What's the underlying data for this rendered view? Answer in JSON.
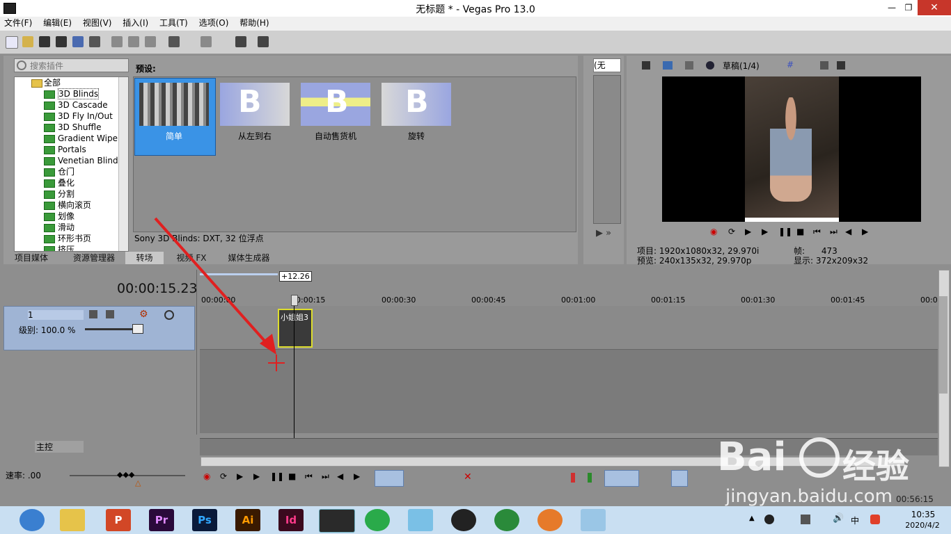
{
  "window": {
    "title": "无标题 * - Vegas Pro 13.0"
  },
  "menu": [
    "文件(F)",
    "编辑(E)",
    "视图(V)",
    "插入(I)",
    "工具(T)",
    "选项(O)",
    "帮助(H)"
  ],
  "plugins": {
    "search_placeholder": "搜索插件",
    "tree": [
      "全部",
      "3D Blinds",
      "3D Cascade",
      "3D Fly In/Out",
      "3D Shuffle",
      "Gradient Wipe",
      "Portals",
      "Venetian Blinds",
      "仓门",
      "叠化",
      "分割",
      "横向滚页",
      "划像",
      "滑动",
      "环形书页",
      "挤压"
    ],
    "presets_label": "预设:",
    "presets": [
      "简单",
      "从左到右",
      "自动售货机",
      "旋转"
    ],
    "status": "Sony 3D Blinds: DXT, 32 位浮点",
    "tabs": [
      "项目媒体",
      "资源管理器",
      "转场",
      "视频 FX",
      "媒体生成器"
    ]
  },
  "trimmer": {
    "dropdown": "(无"
  },
  "preview": {
    "quality": "草稿(1/4)",
    "project_label": "项目:",
    "project_value": "1920x1080x32, 29.970i",
    "preview_label": "预览:",
    "preview_value": "240x135x32, 29.970p",
    "frame_label": "帧:",
    "frame_value": "473",
    "display_label": "显示:",
    "display_value": "372x209x32"
  },
  "timeline": {
    "time": "00:00:15.23",
    "offset": "+12.26",
    "ruler": [
      "00:00:00",
      "00:00:15",
      "00:00:30",
      "00:00:45",
      "00:01:00",
      "00:01:15",
      "00:01:30",
      "00:01:45",
      "00:0"
    ],
    "track_number": "1",
    "level_label": "级别: 100.0 %",
    "clip_name": "小姐姐3",
    "master_label": "主控",
    "rate_label": "速率: .00",
    "end_time": "00:56:15"
  },
  "taskbar": {
    "apps": [
      "P",
      "Pr",
      "Ps",
      "Ai",
      "Id"
    ],
    "ime": "中",
    "clock_time": "10:35",
    "clock_date": "2020/4/2"
  },
  "watermark": {
    "brand": "Bai",
    "text": "经验",
    "url": "jingyan.baidu.com"
  },
  "colors": {
    "accent": "#3a93e6",
    "clip_border": "#dede2e",
    "arrow": "#e02020"
  }
}
